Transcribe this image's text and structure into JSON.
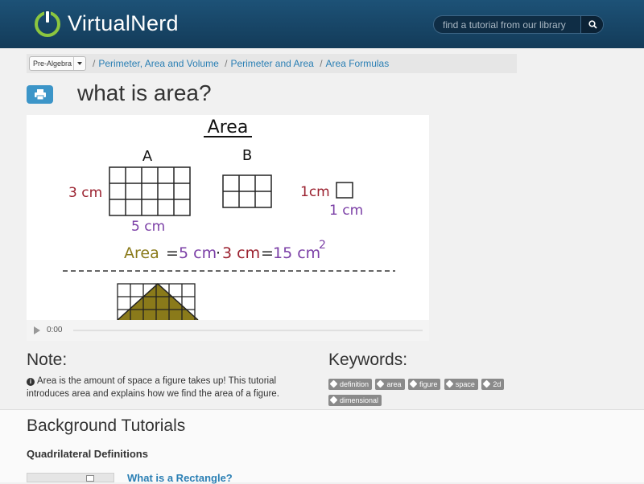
{
  "header": {
    "brand_light": "Virtual",
    "brand_bold": "Nerd",
    "search_placeholder": "find a tutorial from our library",
    "logo_icon": "power-icon",
    "search_icon": "search-icon"
  },
  "breadcrumb": {
    "subject": "Pre-Algebra",
    "items": [
      "Perimeter, Area and Volume",
      "Perimeter and Area",
      "Area Formulas"
    ],
    "separator": "/"
  },
  "title": "what is area?",
  "video": {
    "board": {
      "heading": "Area",
      "label_a": "A",
      "label_b": "B",
      "side_3cm": "3 cm",
      "side_5cm": "5 cm",
      "unit_top": "1cm",
      "unit_bottom": "1 cm",
      "formula_area": "Area",
      "formula_eq1": "=",
      "formula_5cm": "5 cm",
      "formula_dot": "·",
      "formula_3cm": "3 cm",
      "formula_eq2": "=",
      "formula_result": "15 cm",
      "formula_exp": "2"
    },
    "time": "0:00"
  },
  "note": {
    "heading": "Note:",
    "text": "Area is the amount of space a figure takes up! This tutorial introduces area and explains how we find the area of a figure."
  },
  "keywords": {
    "heading": "Keywords:",
    "tags": [
      "definition",
      "area",
      "figure",
      "space",
      "2d",
      "dimensional"
    ]
  },
  "background": {
    "heading": "Background Tutorials",
    "section": "Quadrilateral Definitions",
    "first_tutorial": "What is a Rectangle?"
  },
  "colors": {
    "header_bg": "#174668",
    "link": "#2a7fb4",
    "print_button": "#3c95c8",
    "tag_bg": "#8a8a8a",
    "board_red": "#9b2230",
    "board_purple": "#7b3fa6",
    "board_olive": "#8a7a1a"
  }
}
